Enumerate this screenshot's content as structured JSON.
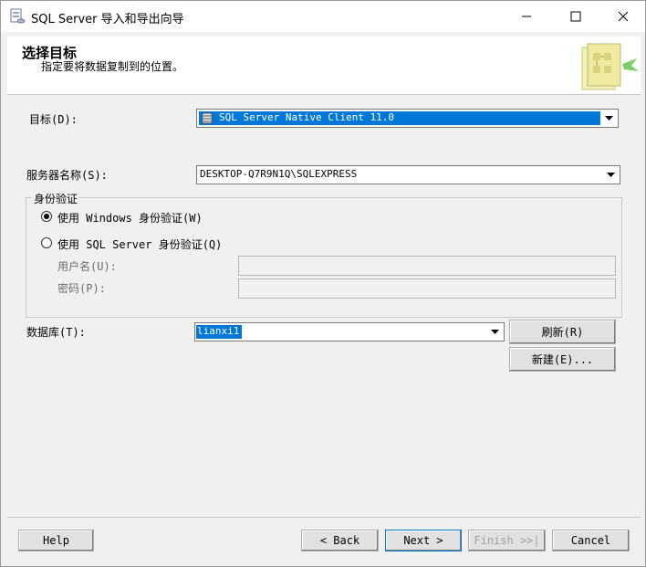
{
  "window": {
    "title": "SQL Server 导入和导出向导"
  },
  "header": {
    "title": "选择目标",
    "subtitle": "指定要将数据复制到的位置。"
  },
  "form": {
    "target_label": "目标(D):",
    "target_value": "SQL Server Native Client 11.0",
    "server_label": "服务器名称(S):",
    "server_value": "DESKTOP-Q7R9N1Q\\SQLEXPRESS",
    "auth_group_title": "身份验证",
    "auth_windows_label": "使用 Windows 身份验证(W)",
    "auth_sql_label": "使用 SQL Server 身份验证(Q)",
    "auth_selected": "windows",
    "username_label": "用户名(U):",
    "password_label": "密码(P):",
    "database_label": "数据库(T):",
    "database_value": "lianxi1",
    "refresh_label": "刷新(R)",
    "new_label": "新建(E)..."
  },
  "footer": {
    "help_label": "Help",
    "back_label": "< Back",
    "next_label": "Next >",
    "finish_label": "Finish >>|",
    "cancel_label": "Cancel"
  },
  "colors": {
    "selection": "#0078d7",
    "window_bg": "#f0f0f0"
  }
}
